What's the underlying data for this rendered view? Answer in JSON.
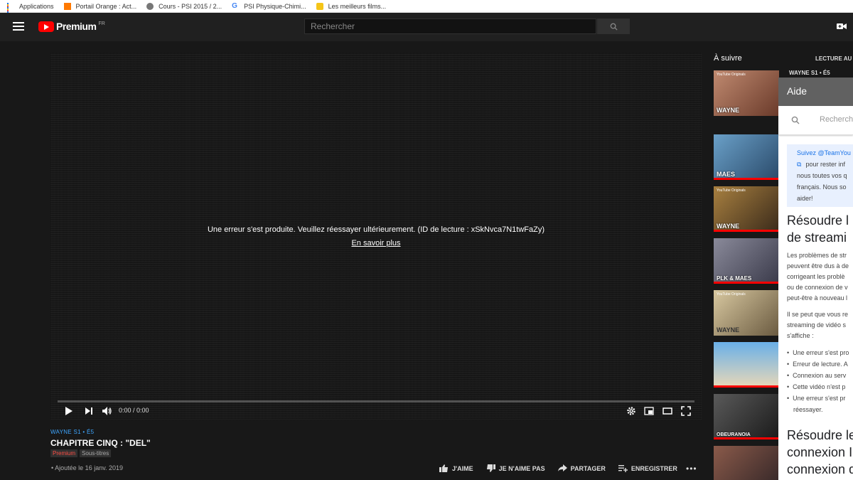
{
  "bookmarks": [
    {
      "label": "Applications",
      "icon": "apps-grid-icon"
    },
    {
      "label": "Portail Orange : Act...",
      "icon": "orange-icon"
    },
    {
      "label": "Cours - PSI 2015 / 2...",
      "icon": "globe-icon"
    },
    {
      "label": "PSI Physique-Chimi...",
      "icon": "google-icon"
    },
    {
      "label": "Les meilleurs films...",
      "icon": "film-icon"
    }
  ],
  "header": {
    "logo_text": "Premium",
    "logo_region": "FR",
    "search_placeholder": "Rechercher"
  },
  "player": {
    "error_message": "Une erreur s'est produite. Veuillez réessayer ultérieurement. (ID de lecture : xSkNvca7N1twFaZy)",
    "learn_more": "En savoir plus",
    "time": "0:00 / 0:00"
  },
  "video": {
    "series": "WAYNE  S1 • É5",
    "title": "CHAPITRE CINQ : \"DEL\"",
    "badge_premium": "Premium",
    "badge_subtitles": "Sous-titres",
    "date": "• Ajoutée le 16 janv. 2019",
    "like": "J'AIME",
    "dislike": "JE N'AIME PAS",
    "share": "PARTAGER",
    "save": "ENREGISTRER"
  },
  "sidebar": {
    "up_next": "À suivre",
    "autoplay": "LECTURE AU",
    "first_meta": "WAYNE  S1 • É5",
    "thumbnails": [
      {
        "label": "WAYNE",
        "top": "YouTube Originals",
        "color": "#8a5a4a"
      },
      {
        "label": "MAES",
        "top": "",
        "color": "#3a6a8a"
      },
      {
        "label": "WAYNE",
        "top": "YouTube Originals",
        "color": "#5a4a2a"
      },
      {
        "label": "PLK & MAES",
        "top": "",
        "color": "#555a66"
      },
      {
        "label": "WAYNE",
        "top": "YouTube Originals",
        "color": "#7a6a50"
      },
      {
        "label": "",
        "top": "",
        "color": "#4a8ac8"
      },
      {
        "label": "OBEURANOIA",
        "top": "",
        "color": "#3a3a3a"
      },
      {
        "label": "",
        "top": "",
        "color": "#6a3a3a"
      }
    ]
  },
  "help": {
    "title": "Aide",
    "search_placeholder": "Rechercher",
    "notice_lines": [
      "Suivez @TeamYou",
      "pour rester inf",
      "nous toutes vos q",
      "français. Nous so",
      "aider!"
    ],
    "heading1": [
      "Résoudre l",
      "de streami"
    ],
    "para1": [
      "Les problèmes de str",
      "peuvent être dus à de",
      "corrigeant les problè",
      "ou de connexion de v",
      "peut-être à nouveau l"
    ],
    "para2": [
      "Il se peut que vous re",
      "streaming de vidéo s",
      "s'affiche :"
    ],
    "bullets": [
      "Une erreur s'est pro",
      "Erreur de lecture. A",
      "Connexion au serv",
      "Cette vidéo n'est p",
      "Une erreur s'est pr"
    ],
    "bullet_cont": "réessayer.",
    "heading2": [
      "Résoudre les",
      "connexion In",
      "connexion d"
    ]
  }
}
